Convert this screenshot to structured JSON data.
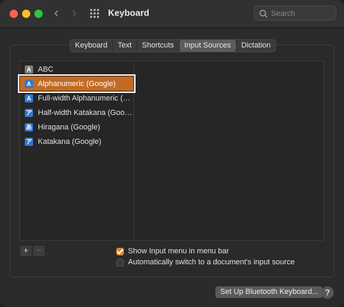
{
  "window": {
    "title": "Keyboard"
  },
  "search": {
    "placeholder": "Search"
  },
  "tabs": [
    {
      "label": "Keyboard"
    },
    {
      "label": "Text"
    },
    {
      "label": "Shortcuts"
    },
    {
      "label": "Input Sources",
      "active": true
    },
    {
      "label": "Dictation"
    }
  ],
  "input_sources": [
    {
      "badge": "A",
      "badge_color": "#7c7c7c",
      "label": "ABC"
    },
    {
      "badge": "A",
      "badge_color": "#2f77d3",
      "label": "Alphanumeric (Google)",
      "selected": true
    },
    {
      "badge": "A",
      "badge_color": "#2f77d3",
      "label": "Full-width Alphanumeric (G..."
    },
    {
      "badge": "ア",
      "badge_color": "#2f77d3",
      "label": "Half-width Katakana (Googl..."
    },
    {
      "badge": "あ",
      "badge_color": "#2f77d3",
      "label": "Hiragana (Google)"
    },
    {
      "badge": "ア",
      "badge_color": "#2f77d3",
      "label": "Katakana (Google)"
    }
  ],
  "list_controls": {
    "add": "+",
    "remove": "−"
  },
  "options": {
    "show_menu": {
      "label": "Show Input menu in menu bar",
      "checked": true
    },
    "auto_switch": {
      "label": "Automatically switch to a document's input source",
      "checked": false
    }
  },
  "bluetooth_button": "Set Up Bluetooth Keyboard...",
  "help": "?",
  "accent_color": "#c16b24"
}
